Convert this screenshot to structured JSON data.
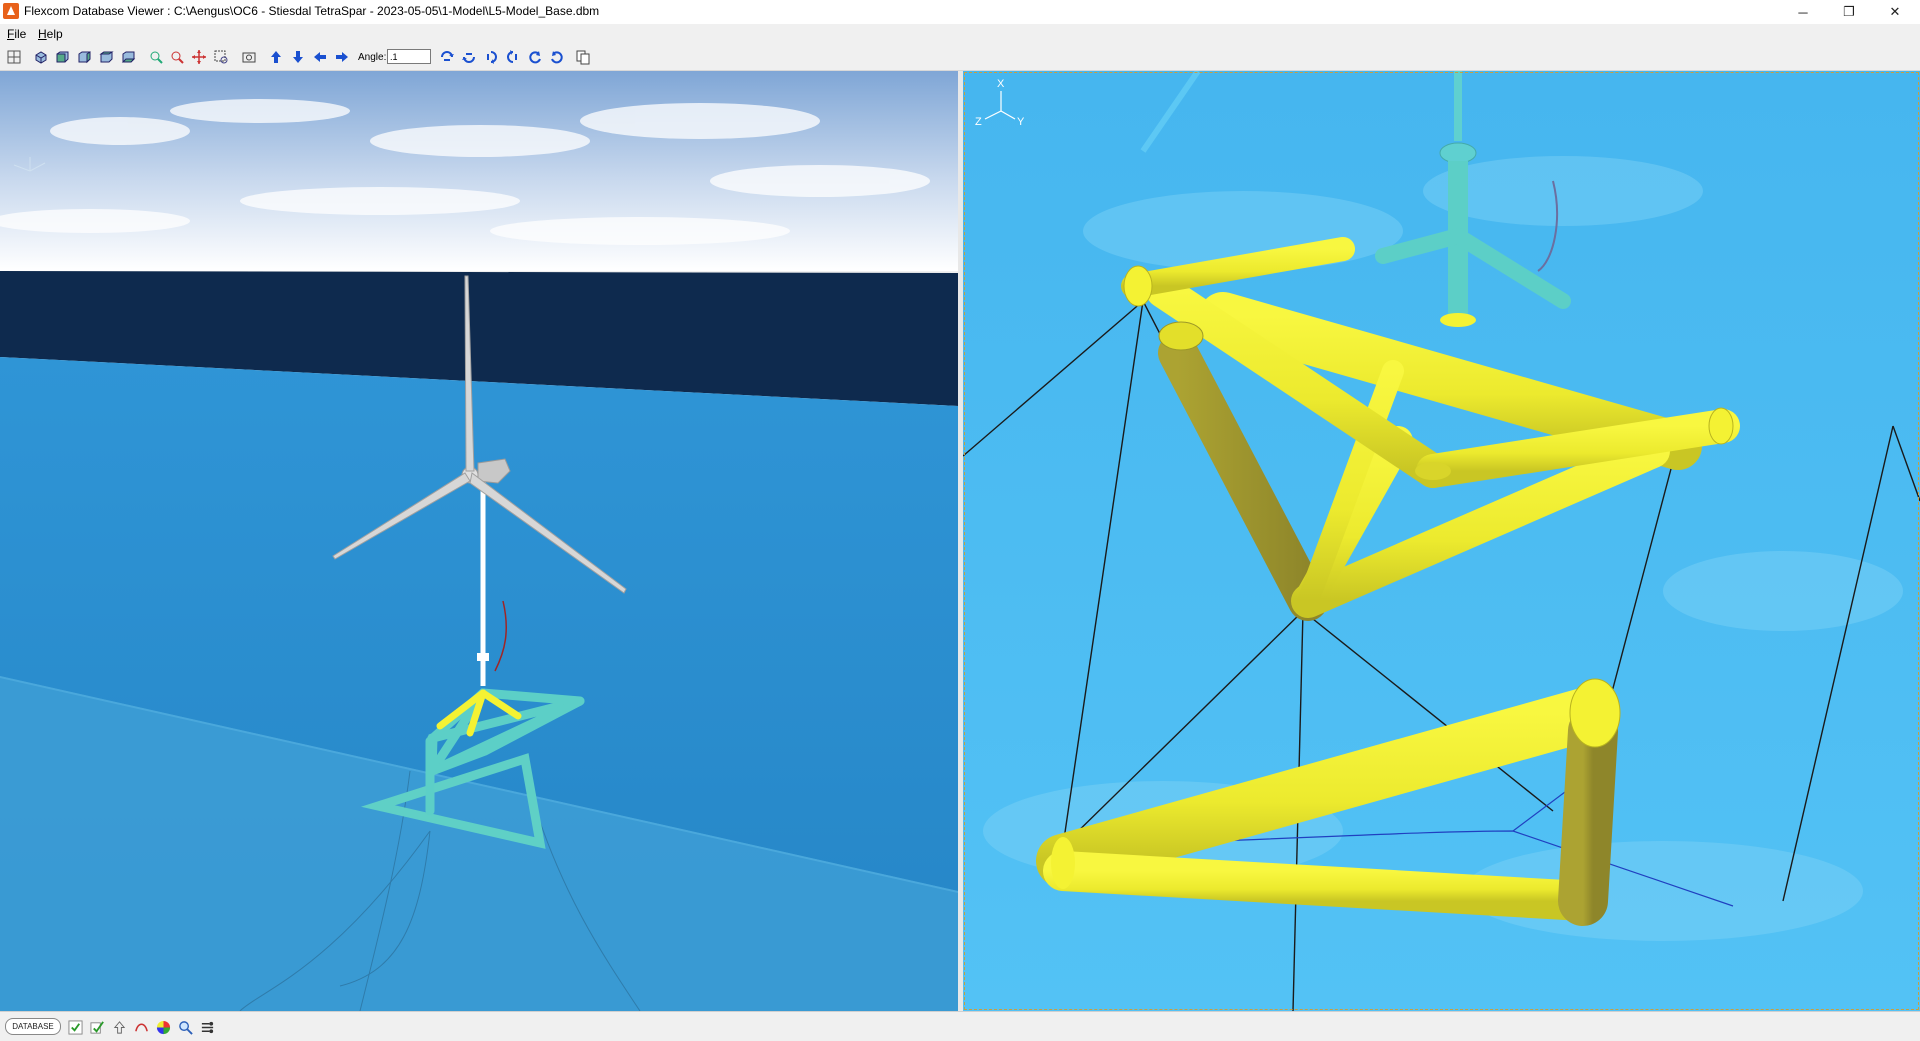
{
  "window": {
    "title": "Flexcom Database Viewer : C:\\Aengus\\OC6 - Stiesdal TetraSpar - 2023-05-05\\1-Model\\L5-Model_Base.dbm",
    "minimize": "─",
    "restore": "❐",
    "close": "✕"
  },
  "menu": {
    "file": {
      "accel": "F",
      "rest": "ile"
    },
    "help": {
      "accel": "H",
      "rest": "elp"
    }
  },
  "toolbar": {
    "angle_label": "Angle:",
    "angle_value": ".1",
    "icons": [
      "grid-icon",
      "view-iso-icon",
      "view-front-icon",
      "view-side-icon",
      "view-top-icon",
      "view-bottom-icon",
      "zoom-fit-icon",
      "zoom-prev-icon",
      "pan-icon",
      "zoom-box-icon",
      "snapshot-icon",
      "arrow-up-icon",
      "arrow-down-icon",
      "arrow-left-icon",
      "arrow-right-icon",
      "rotate-x-icon",
      "rotate-y-icon",
      "rotate-z-icon",
      "rotate-up-icon",
      "rotate-ccw-icon",
      "rotate-cw-icon",
      "copy-icon"
    ]
  },
  "views": {
    "left": {
      "name": "scene-view",
      "axes": {
        "x": "X",
        "y": "Y",
        "z": "Z"
      }
    },
    "right": {
      "name": "closeup-view",
      "axes": {
        "x": "X",
        "y": "Y",
        "z": "Z"
      }
    }
  },
  "colors": {
    "sky_top": "#8fb4dc",
    "sea_dark": "#0e2a4e",
    "sea": "#2a8fd0",
    "structure_yellow": "#f4f233",
    "structure_teal": "#5ccfc7",
    "right_bg": "#4dbef2"
  },
  "statusbar": {
    "database_label": "DATABASE",
    "icons": [
      "check-icon",
      "check-list-icon",
      "up-arrow-icon",
      "curve-icon",
      "color-wheel-icon",
      "magnifier-icon",
      "settings-icon"
    ]
  }
}
